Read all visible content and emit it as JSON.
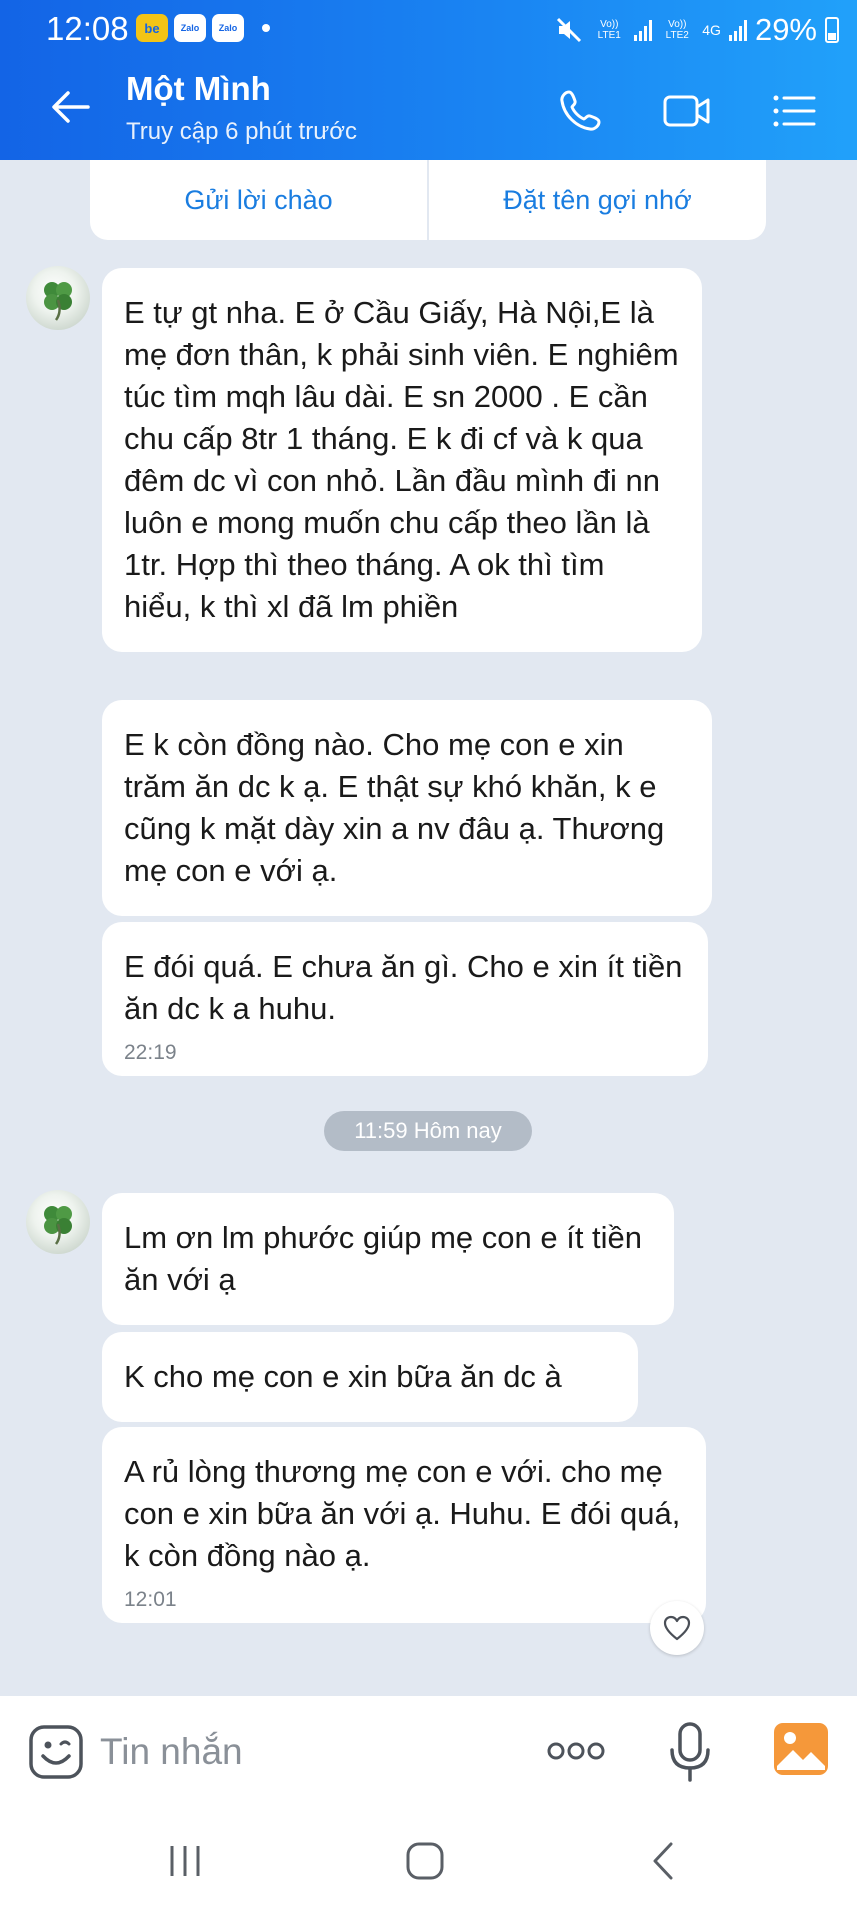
{
  "status_bar": {
    "time": "12:08",
    "apps": [
      "be",
      "Zalo",
      "Zalo"
    ],
    "sim1": "Vo)) LTE1",
    "sim2": "Vo)) LTE2",
    "network": "4G",
    "battery": "29%",
    "battery_level": 0.29
  },
  "header": {
    "title": "Một Mình",
    "subtitle": "Truy cập 6 phút trước",
    "icons": [
      "back-arrow-icon",
      "phone-icon",
      "video-call-icon",
      "menu-icon"
    ]
  },
  "greeting_bar": {
    "left_label": "Gửi lời chào",
    "right_label": "Đặt tên gợi nhớ"
  },
  "messages": [
    {
      "text": "E tự gt nha. E ở Cầu Giấy, Hà Nội,E là mẹ đơn thân, k phải sinh viên. E nghiêm túc tìm mqh lâu dài. E sn 2000 . E cần chu cấp 8tr 1 tháng. E k đi cf và k qua đêm dc vì con nhỏ. Lần đầu mình đi nn luôn e mong muốn chu cấp theo lần là 1tr. Hợp thì theo tháng. A ok thì tìm hiểu, k thì xl đã lm phiền"
    },
    {
      "text": "E k còn đồng nào. Cho mẹ con e xin trăm ăn dc k ạ. E thật sự khó khăn, k e cũng k mặt dày xin a nv đâu ạ. Thương mẹ con e với ạ."
    },
    {
      "text": "E đói quá. E chưa ăn gì. Cho e xin ít tiền ăn dc k a huhu.",
      "time": "22:19"
    },
    {
      "text": "Lm ơn lm phước giúp mẹ con e ít tiền ăn với ạ"
    },
    {
      "text": "K cho mẹ con e xin bữa ăn dc à"
    },
    {
      "text": "A rủ lòng thương mẹ con e với. cho mẹ con e xin bữa ăn với ạ. Huhu. E đói quá, k còn đồng nào ạ.",
      "time": "12:01"
    }
  ],
  "day_separator": "11:59 Hôm nay",
  "composer": {
    "placeholder": "Tin nhắn",
    "icons": [
      "emoji-icon",
      "more-icon",
      "microphone-icon",
      "gallery-icon"
    ]
  },
  "colors": {
    "header_start": "#1364e6",
    "header_end": "#21a1fa",
    "chat_bg": "#e2e8f1",
    "accent": "#1a7de0",
    "gallery": "#f5983a"
  }
}
